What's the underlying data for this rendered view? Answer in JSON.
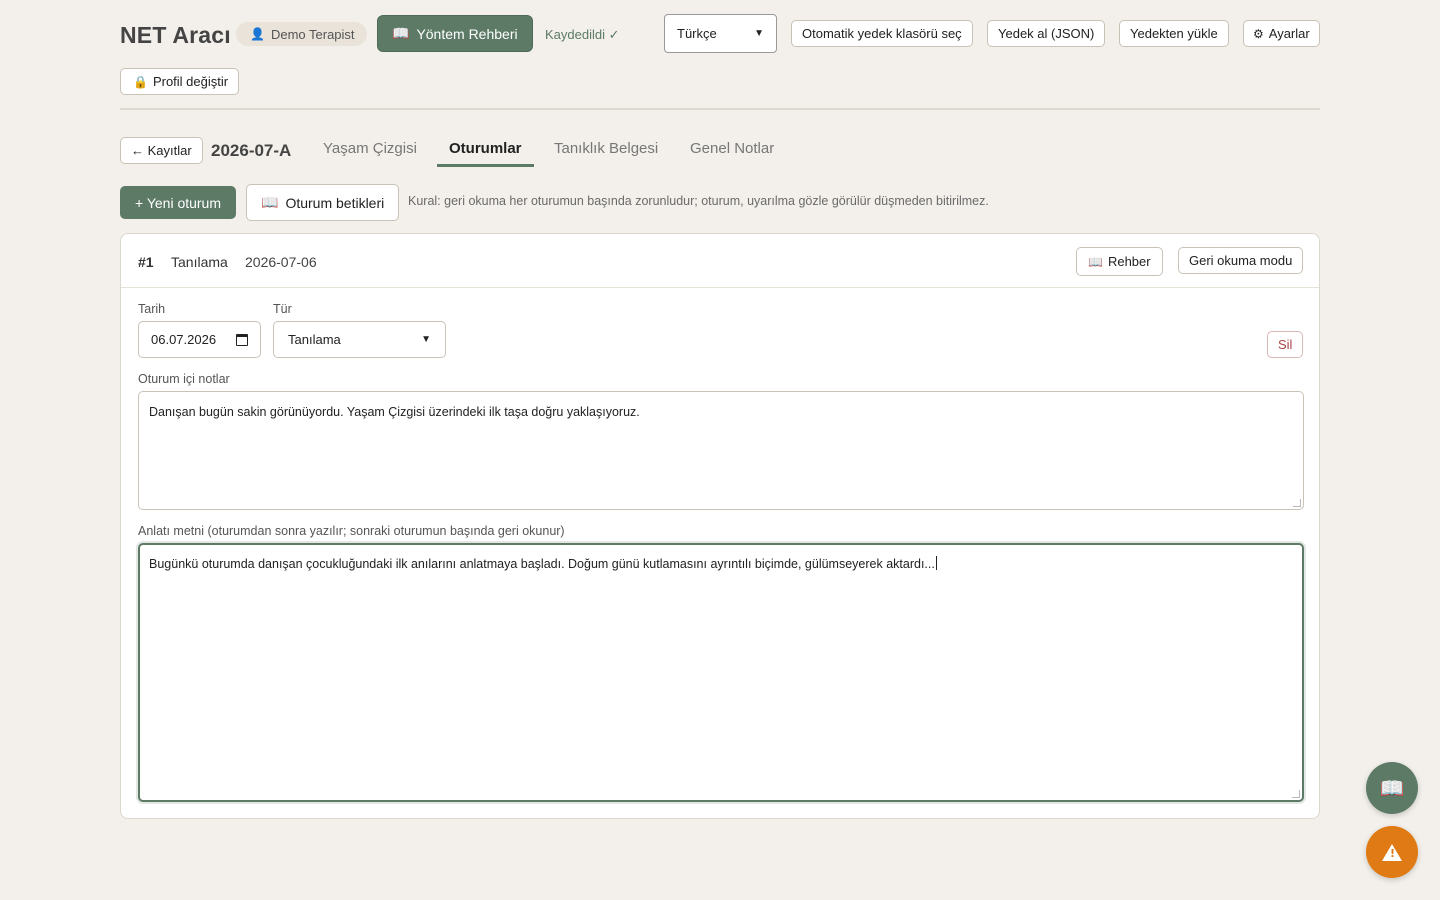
{
  "header": {
    "app_title": "NET Aracı",
    "user_name": "Demo Terapist",
    "guide_label": "Yöntem Rehberi",
    "saved_status": "Kaydedildi ✓",
    "language": "Türkçe",
    "auto_backup_label": "Otomatik yedek klasörü seç",
    "backup_label": "Yedek al (JSON)",
    "restore_label": "Yedekten yükle",
    "settings_label": "Ayarlar",
    "profile_switch_label": "Profil değiştir"
  },
  "record": {
    "back_label": "← Kayıtlar",
    "id": "2026-07-A",
    "tabs": [
      {
        "label": "Yaşam Çizgisi",
        "active": false
      },
      {
        "label": "Oturumlar",
        "active": true
      },
      {
        "label": "Tanıklık Belgesi",
        "active": false
      },
      {
        "label": "Genel Notlar",
        "active": false
      }
    ]
  },
  "actions": {
    "new_session_label": "+ Yeni oturum",
    "session_scripts_label": "Oturum betikleri",
    "rule_text": "Kural: geri okuma her oturumun başında zorunludur; oturum, uyarılma gözle görülür düşmeden bitirilmez."
  },
  "session": {
    "number": "#1",
    "type": "Tanılama",
    "date": "2026-07-06",
    "guide_label": "Rehber",
    "readback_label": "Geri okuma modu",
    "date_field_label": "Tarih",
    "date_value": "06.07.2026",
    "type_field_label": "Tür",
    "type_value": "Tanılama",
    "delete_label": "Sil",
    "notes_label": "Oturum içi notlar",
    "notes_value": "Danışan bugün sakin görünüyordu. Yaşam Çizgisi üzerindeki ilk taşa doğru yaklaşıyoruz.",
    "narrative_label": "Anlatı metni (oturumdan sonra yazılır; sonraki oturumun başında geri okunur)",
    "narrative_value": "Bugünkü oturumda danışan çocukluğundaki ilk anılarını anlatmaya başladı. Doğum günü kutlamasını ayrıntılı biçimde, gülümseyerek aktardı..."
  },
  "icons": {
    "user": "person-icon",
    "book": "book-icon",
    "gear": "gear-icon",
    "lock": "lock-icon",
    "alert": "warning-icon"
  },
  "colors": {
    "accent": "#5c7a66",
    "background": "#f3f0eb",
    "alert": "#e07a14",
    "danger": "#a44444"
  }
}
